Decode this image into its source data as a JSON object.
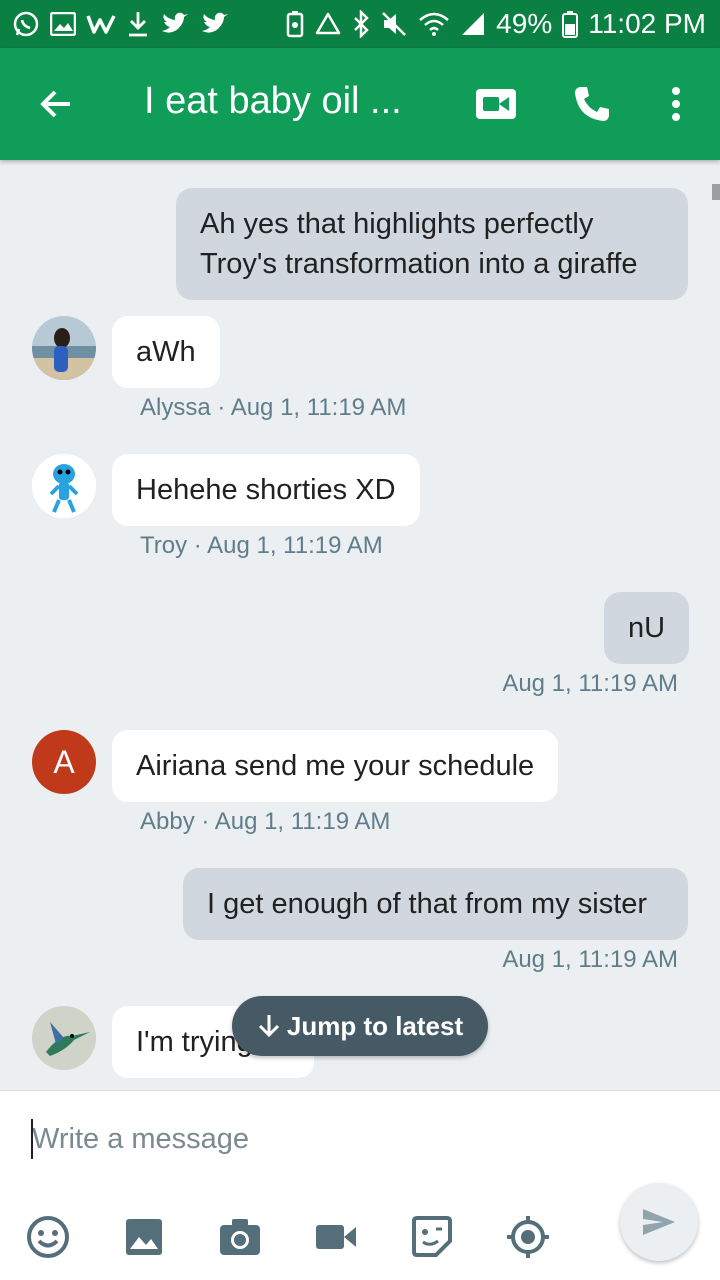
{
  "status_bar": {
    "battery": "49%",
    "time": "11:02 PM",
    "left_icons": [
      "whatsapp-icon",
      "gallery-icon",
      "w-app-icon",
      "download-icon",
      "twitter-icon",
      "twitter-icon"
    ],
    "right_icons": [
      "battery-saver-icon",
      "recycle-icon",
      "bluetooth-icon",
      "mute-icon",
      "wifi-icon",
      "signal-icon",
      "battery-icon"
    ]
  },
  "app_bar": {
    "title": "I eat baby oil ...",
    "icons": [
      "back-arrow-icon",
      "video-call-icon",
      "phone-icon",
      "more-vert-icon"
    ]
  },
  "messages": [
    {
      "direction": "out",
      "lines": [
        "Ah yes that highlights perfectly",
        "Troy's transformation into a giraffe"
      ],
      "meta": ""
    },
    {
      "direction": "in",
      "text": "aWh",
      "meta": "Alyssa · Aug 1, 11:19 AM"
    },
    {
      "direction": "in",
      "text": "Hehehe shorties XD",
      "meta": "Troy · Aug 1, 11:19 AM"
    },
    {
      "direction": "out",
      "text": "nU",
      "meta": "Aug 1, 11:19 AM"
    },
    {
      "direction": "in",
      "text": "Airiana send me your schedule",
      "meta": "Abby · Aug 1, 11:19 AM",
      "avatar_letter": "A"
    },
    {
      "direction": "out",
      "text": "I get enough of that from my sister",
      "meta": "Aug 1, 11:19 AM"
    },
    {
      "direction": "in",
      "text": "I'm trying to",
      "meta": ""
    }
  ],
  "jump_button": {
    "label": "Jump to latest",
    "icon": "arrow-down-icon"
  },
  "composer": {
    "placeholder": "Write a message",
    "tools": [
      "emoji-icon",
      "image-icon",
      "camera-icon",
      "video-icon",
      "sticker-icon",
      "location-icon"
    ],
    "send_icon": "send-icon"
  },
  "colors": {
    "status_bar": "#0b8043",
    "app_bar": "#0f9d58",
    "chat_bg": "#eceff1",
    "outgoing_bubble": "#d0d7de",
    "incoming_bubble": "#ffffff",
    "abby_avatar": "#c1391b",
    "jump_pill": "#455a64"
  }
}
